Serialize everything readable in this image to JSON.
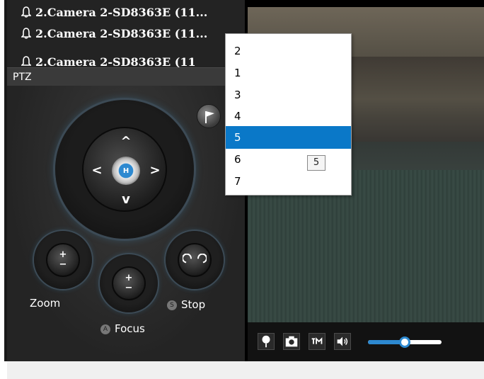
{
  "camera_list": {
    "items": [
      {
        "label": "2.Camera 2-SD8363E (11..."
      },
      {
        "label": "2.Camera 2-SD8363E (11..."
      },
      {
        "label": "2.Camera 2-SD8363E (11"
      }
    ]
  },
  "ptz": {
    "title": "PTZ",
    "home_label": "H",
    "zoom_label": "Zoom",
    "focus_label": "Focus",
    "stop_label": "Stop",
    "zoom_in": "+",
    "zoom_out": "−",
    "focus_near": "+",
    "focus_far": "−",
    "arrow_up": "^",
    "arrow_down": "v",
    "arrow_left": "<",
    "arrow_right": ">",
    "accent_color": "#2d89d0"
  },
  "preset_dropdown": {
    "options": [
      "2",
      "1",
      "3",
      "4",
      "5",
      "6",
      "7"
    ],
    "selected": "5",
    "selected_color": "#0a78c8",
    "tooltip": "5"
  },
  "video_controls": {
    "icons": [
      "pin-icon",
      "snapshot-icon",
      "ptz-icon",
      "speaker-icon"
    ],
    "volume_level": 0.5
  }
}
